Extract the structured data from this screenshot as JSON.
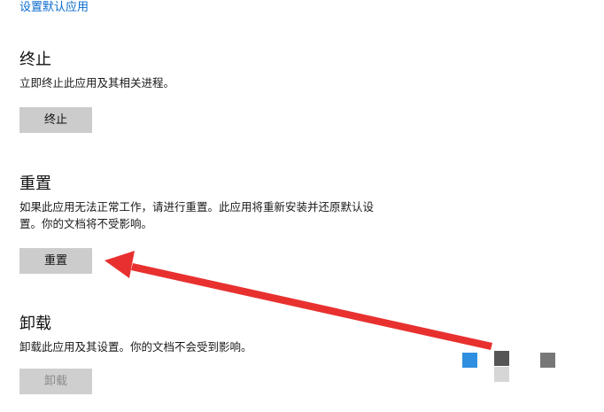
{
  "top_link": "设置默认应用",
  "terminate": {
    "title": "终止",
    "description": "立即终止此应用及其相关进程。",
    "button_label": "终止"
  },
  "reset": {
    "title": "重置",
    "description": "如果此应用无法正常工作，请进行重置。此应用将重新安装并还原默认设置。你的文档将不受影响。",
    "button_label": "重置"
  },
  "uninstall": {
    "title": "卸载",
    "description": "卸载此应用及其设置。你的文档不会受到影响。",
    "button_label": "卸载",
    "button_disabled": true
  },
  "annotation": {
    "arrow_color": "#e8312f",
    "points_to": "reset-button"
  }
}
